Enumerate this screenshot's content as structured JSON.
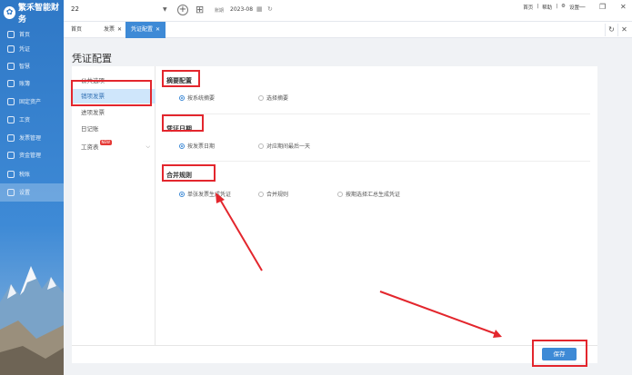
{
  "app": {
    "logo_text": "繁禾智能财务"
  },
  "sidebar": {
    "items": [
      {
        "label": "首页",
        "icon": "home-icon"
      },
      {
        "label": "凭证",
        "icon": "voucher-icon"
      },
      {
        "label": "智慧",
        "icon": "smart-icon"
      },
      {
        "label": "账簿",
        "icon": "ledger-icon"
      },
      {
        "label": "固定资产",
        "icon": "asset-icon"
      },
      {
        "label": "工资",
        "icon": "salary-icon"
      },
      {
        "label": "发票管理",
        "icon": "invoice-icon"
      },
      {
        "label": "资金管理",
        "icon": "fund-icon"
      },
      {
        "label": "税账",
        "icon": "tax-icon"
      },
      {
        "label": "设置",
        "icon": "settings-icon"
      }
    ],
    "active_index": 9
  },
  "topbar": {
    "account": "22",
    "period_label": "账期",
    "period_value": "2023-08",
    "links": [
      "首页",
      "帮助",
      "设置"
    ]
  },
  "tabs": [
    {
      "label": "首页"
    },
    {
      "label": "发票"
    },
    {
      "label": "凭证配置"
    }
  ],
  "page": {
    "title": "凭证配置",
    "menu": [
      {
        "label": "公共选项"
      },
      {
        "label": "销项发票"
      },
      {
        "label": "进项发票"
      },
      {
        "label": "日记账"
      },
      {
        "label": "工资表",
        "badge": "NEW"
      }
    ],
    "menu_active_index": 1,
    "sections": {
      "summary": {
        "title": "摘要配置",
        "options": [
          "按系统摘要",
          "选择摘要"
        ],
        "selected": 0
      },
      "date": {
        "title": "凭证日期",
        "options": [
          "按发票日期",
          "对应期间最后一天"
        ],
        "selected": 0
      },
      "merge": {
        "title": "合并规则",
        "options": [
          "单张发票生成凭证",
          "合并规则",
          "按期选择汇总生成凭证"
        ],
        "selected": 0
      }
    },
    "save_label": "保存"
  },
  "colors": {
    "accent": "#3e8ad6",
    "highlight": "#e3262d"
  }
}
